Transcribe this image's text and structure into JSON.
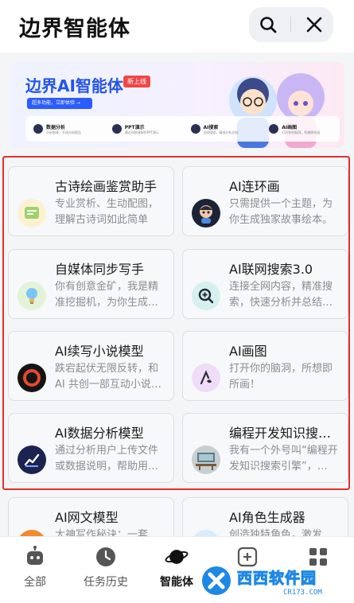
{
  "header": {
    "title": "边界智能体"
  },
  "banner": {
    "title": "边界AI智能体",
    "tag": "新上线",
    "button": "超多功能，立即体验 →",
    "features": [
      {
        "title": "数据分析",
        "sub": "分析图表，生成分析报告"
      },
      {
        "title": "PPT演示",
        "sub": "通过AI快速制作PPT演示"
      },
      {
        "title": "AI搜索",
        "sub": "全网搜索，精准分析总结"
      },
      {
        "title": "AI画图",
        "sub": "打开你的脑洞，所想即所画"
      }
    ]
  },
  "cards": [
    {
      "title": "古诗绘画鉴赏助手",
      "desc": "专业赏析、生动配图，理解古诗词如此简单",
      "icon": "poem-icon"
    },
    {
      "title": "AI连环画",
      "desc": "只需提供一个主题，为你生成独家故事绘本。",
      "icon": "comic-avatar-icon"
    },
    {
      "title": "自媒体同步写手",
      "desc": "你有创意金矿，我是精准挖掘机，为你生成…",
      "icon": "lightbulb-icon"
    },
    {
      "title": "AI联网搜索3.0",
      "desc": "连接全网内容，精准搜索，快速分析并总结…",
      "icon": "search-plus-icon"
    },
    {
      "title": "AI续写小说模型",
      "desc": "跌宕起伏无限反转，和AI 共创一部互动小说…",
      "icon": "ring-icon"
    },
    {
      "title": "AI画图",
      "desc": "打开你的脑洞，所想即所画！",
      "icon": "paint-icon"
    },
    {
      "title": "AI数据分析模型",
      "desc": "通过分析用户上传文件或数据说明，帮助用…",
      "icon": "chart-icon"
    },
    {
      "title": "编程开发知识搜…",
      "desc": "我有一个外号叫“编程开发知识搜索引擎”，…",
      "icon": "desk-photo-icon"
    },
    {
      "title": "AI网文模型",
      "desc": "大神写作秘诀：一套模…",
      "icon": "book-icon"
    },
    {
      "title": "AI角色生成器",
      "desc": "创造独特角色，激发无…",
      "icon": "character-icon"
    }
  ],
  "tabs": [
    {
      "label": "全部",
      "icon": "robot-icon",
      "active": false
    },
    {
      "label": "任务历史",
      "icon": "clock-icon",
      "active": false
    },
    {
      "label": "智能体",
      "icon": "planet-icon",
      "active": true
    },
    {
      "label": "",
      "icon": "add-icon",
      "active": false
    },
    {
      "label": "",
      "icon": "grid-icon",
      "active": false
    }
  ],
  "watermark": {
    "text": "西西软件园",
    "url": "CR173.COM"
  },
  "colors": {
    "accent": "#2454e8",
    "highlight": "#e0312e",
    "brand_blue": "#1e88e5"
  }
}
